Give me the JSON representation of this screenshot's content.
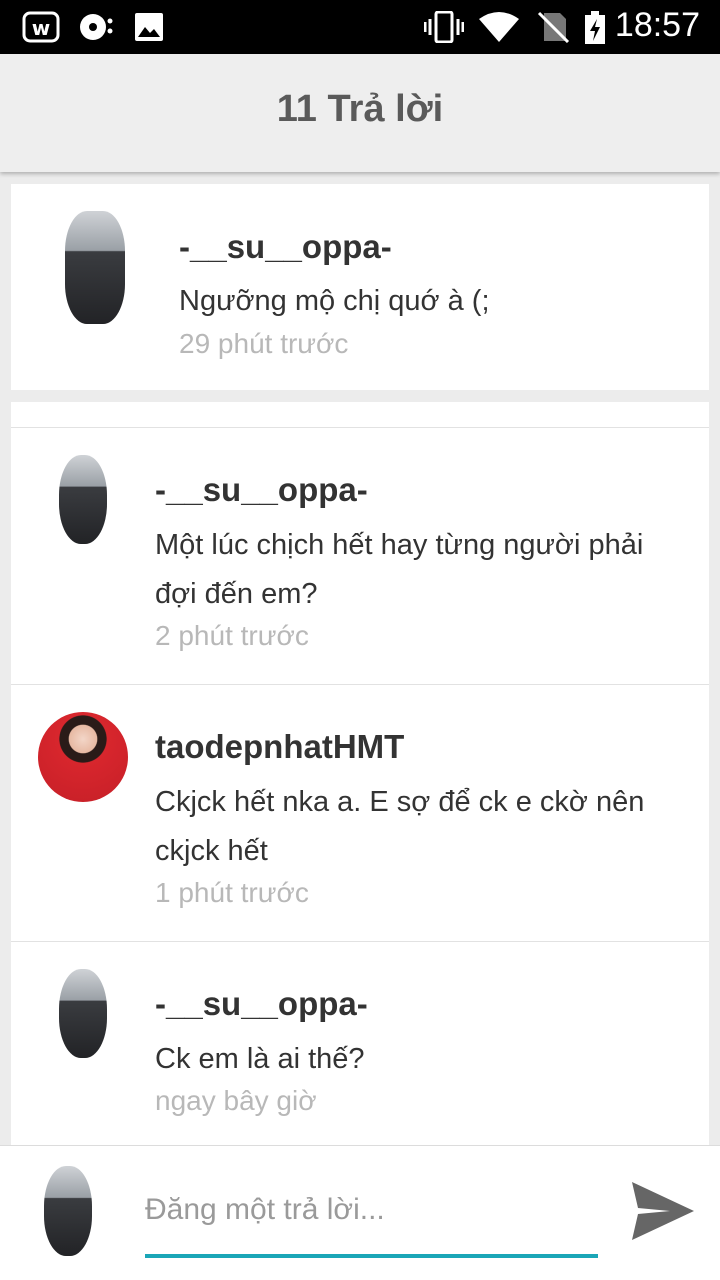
{
  "status_bar": {
    "time": "18:57",
    "icons": [
      "app-w-icon",
      "music-icon",
      "image-icon",
      "vibrate-icon",
      "wifi-icon",
      "no-sim-icon",
      "battery-charging-icon"
    ]
  },
  "header": {
    "title": "11 Trả lời"
  },
  "original_post": {
    "username": "-__su__oppa-",
    "text": "Ngưỡng mộ chị quớ à (;",
    "time": "29 phút trước"
  },
  "replies": [
    {
      "username": "-__su__oppa-",
      "text": "Một lúc chịch hết hay từng người phải đợi đến em?",
      "time": "2 phút trước",
      "avatar": "male"
    },
    {
      "username": "taodepnhatHMT",
      "text": "Ckjck hết nka a. E sợ để ck e ckờ nên ckjck hết",
      "time": "1 phút trước",
      "avatar": "female"
    },
    {
      "username": "-__su__oppa-",
      "text": "Ck em là ai thế?",
      "time": "ngay bây giờ",
      "avatar": "male"
    }
  ],
  "reply_box": {
    "placeholder": "Đăng một trả lời...",
    "value": "",
    "send_icon": "send-icon"
  }
}
